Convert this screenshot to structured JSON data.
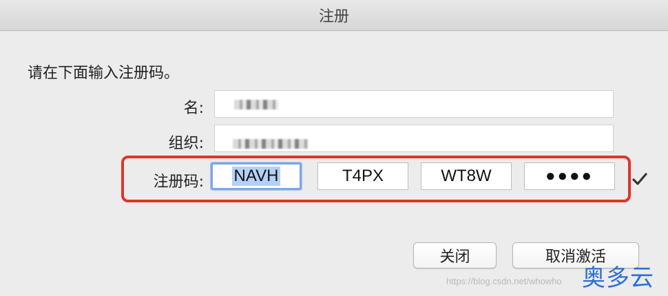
{
  "window": {
    "title": "注册"
  },
  "form": {
    "instruction": "请在下面输入注册码。",
    "name_label": "名:",
    "org_label": "组织:",
    "code_label": "注册码:",
    "code_segments": [
      "NAVH",
      "T4PX",
      "WT8W",
      "●●●●"
    ]
  },
  "buttons": {
    "close_label": "关闭",
    "deactivate_label": "取消激活"
  },
  "watermark": {
    "url": "https://blog.csdn.net/whowho",
    "brand": "奥多云"
  },
  "colors": {
    "highlight_border": "#e0342c",
    "focus_ring": "#7da7e6",
    "selection": "#b3d1f7",
    "brand": "#2e6fd6"
  }
}
